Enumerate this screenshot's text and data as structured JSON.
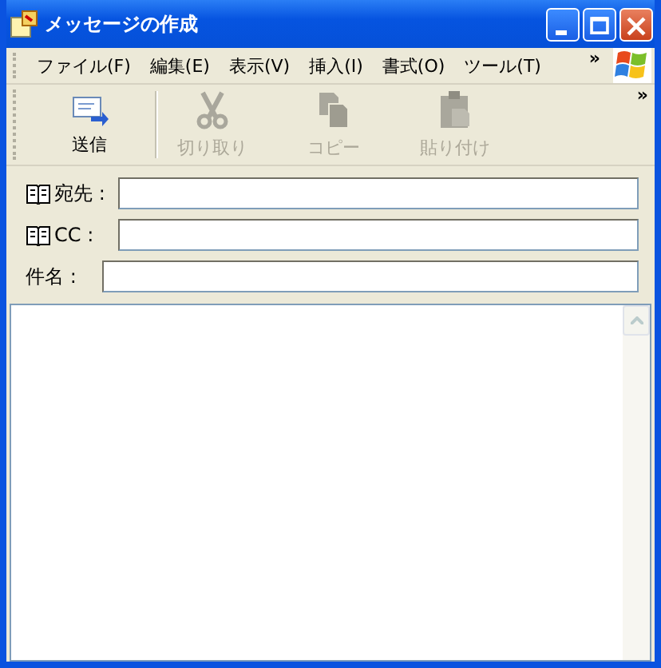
{
  "window": {
    "title": "メッセージの作成"
  },
  "menu": {
    "items": [
      {
        "label": "ファイル(F)"
      },
      {
        "label": "編集(E)"
      },
      {
        "label": "表示(V)"
      },
      {
        "label": "挿入(I)"
      },
      {
        "label": "書式(O)"
      },
      {
        "label": "ツール(T)"
      }
    ],
    "overflow": "»"
  },
  "toolbar": {
    "buttons": [
      {
        "label": "送信",
        "kind": "send",
        "disabled": false
      },
      {
        "label": "切り取り",
        "kind": "cut",
        "disabled": true
      },
      {
        "label": "コピー",
        "kind": "copy",
        "disabled": true
      },
      {
        "label": "貼り付け",
        "kind": "paste",
        "disabled": true
      }
    ],
    "overflow": "»"
  },
  "fields": [
    {
      "label": "宛先 :",
      "kind": "book"
    },
    {
      "label": "CC :",
      "kind": "book"
    },
    {
      "label": "件名 :",
      "kind": "plain"
    }
  ]
}
